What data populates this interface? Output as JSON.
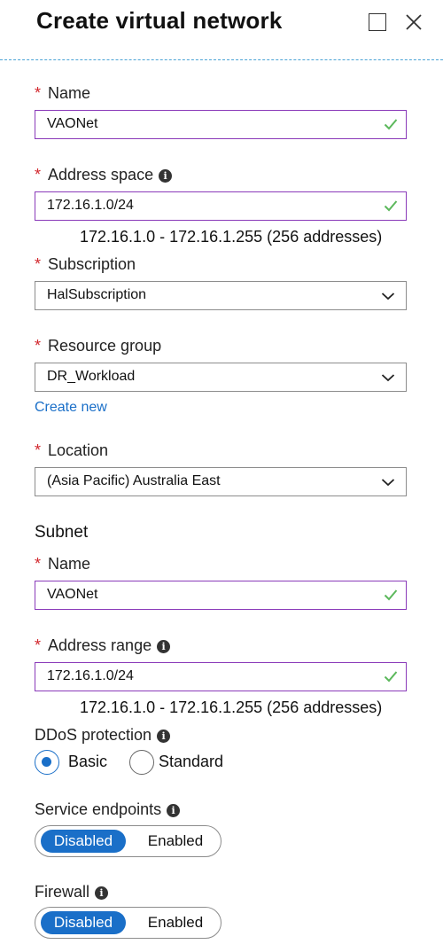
{
  "header": {
    "title": "Create virtual network"
  },
  "form": {
    "name": {
      "label": "Name",
      "value": "VAONet"
    },
    "address_space": {
      "label": "Address space",
      "value": "172.16.1.0/24",
      "hint": "172.16.1.0 - 172.16.1.255 (256 addresses)"
    },
    "subscription": {
      "label": "Subscription",
      "value": "HalSubscription"
    },
    "resource_group": {
      "label": "Resource group",
      "value": "DR_Workload",
      "create_new": "Create new"
    },
    "location": {
      "label": "Location",
      "value": "(Asia Pacific) Australia East"
    }
  },
  "subnet": {
    "heading": "Subnet",
    "name": {
      "label": "Name",
      "value": "VAONet"
    },
    "address_range": {
      "label": "Address range",
      "value": "172.16.1.0/24",
      "hint": "172.16.1.0 - 172.16.1.255 (256 addresses)"
    }
  },
  "ddos": {
    "label": "DDoS protection",
    "options": [
      "Basic",
      "Standard"
    ],
    "selected": "Basic"
  },
  "service_endpoints": {
    "label": "Service endpoints",
    "on_label": "Disabled",
    "off_label": "Enabled",
    "selected": "Disabled"
  },
  "firewall": {
    "label": "Firewall",
    "on_label": "Disabled",
    "off_label": "Enabled",
    "selected": "Disabled"
  },
  "colors": {
    "accent": "#1a6fc8",
    "required": "#d2272d",
    "valid_border": "#8a3ab9",
    "check": "#5cb85c",
    "divider": "#4ba3d6"
  },
  "icons": {
    "info": "info-icon",
    "check": "checkmark-icon",
    "dropdown": "chevron-down-icon",
    "maximize": "maximize-icon",
    "close": "close-icon"
  }
}
